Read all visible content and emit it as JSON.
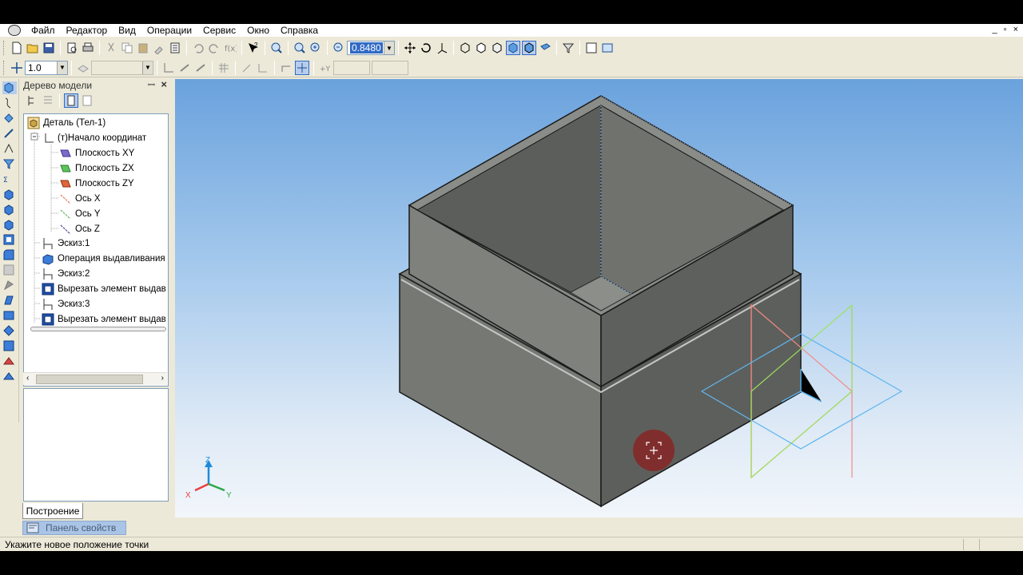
{
  "menu": {
    "items": [
      "Файл",
      "Редактор",
      "Вид",
      "Операции",
      "Сервис",
      "Окно",
      "Справка"
    ]
  },
  "toolbar": {
    "zoom_value": "0.8480",
    "step_value": "1.0"
  },
  "tree_panel": {
    "title": "Дерево модели",
    "nodes": [
      {
        "label": "Деталь (Тел-1)",
        "icon": "part-icon"
      },
      {
        "label": "(т)Начало координат",
        "icon": "origin-icon"
      },
      {
        "label": "Плоскость XY",
        "icon": "plane-xy-icon"
      },
      {
        "label": "Плоскость ZX",
        "icon": "plane-zx-icon"
      },
      {
        "label": "Плоскость ZY",
        "icon": "plane-zy-icon"
      },
      {
        "label": "Ось X",
        "icon": "axis-x-icon"
      },
      {
        "label": "Ось Y",
        "icon": "axis-y-icon"
      },
      {
        "label": "Ось Z",
        "icon": "axis-z-icon"
      },
      {
        "label": "Эскиз:1",
        "icon": "sketch-icon"
      },
      {
        "label": "Операция выдавливания",
        "icon": "extrude-icon"
      },
      {
        "label": "Эскиз:2",
        "icon": "sketch-icon"
      },
      {
        "label": "Вырезать элемент выдав",
        "icon": "cut-extrude-icon"
      },
      {
        "label": "Эскиз:3",
        "icon": "sketch-icon"
      },
      {
        "label": "Вырезать элемент выдав",
        "icon": "cut-extrude-icon"
      }
    ],
    "tab_label": "Построение"
  },
  "properties_panel": {
    "label": "Панель свойств"
  },
  "status_bar": {
    "text": "Укажите новое положение точки"
  },
  "triad": {
    "x": "X",
    "y": "Y",
    "z": "Z"
  },
  "colors": {
    "model_face_light": "#7a7c78",
    "model_face_dark": "#585a57",
    "model_edge": "#1f1f1f",
    "accent": "#316ac5"
  }
}
